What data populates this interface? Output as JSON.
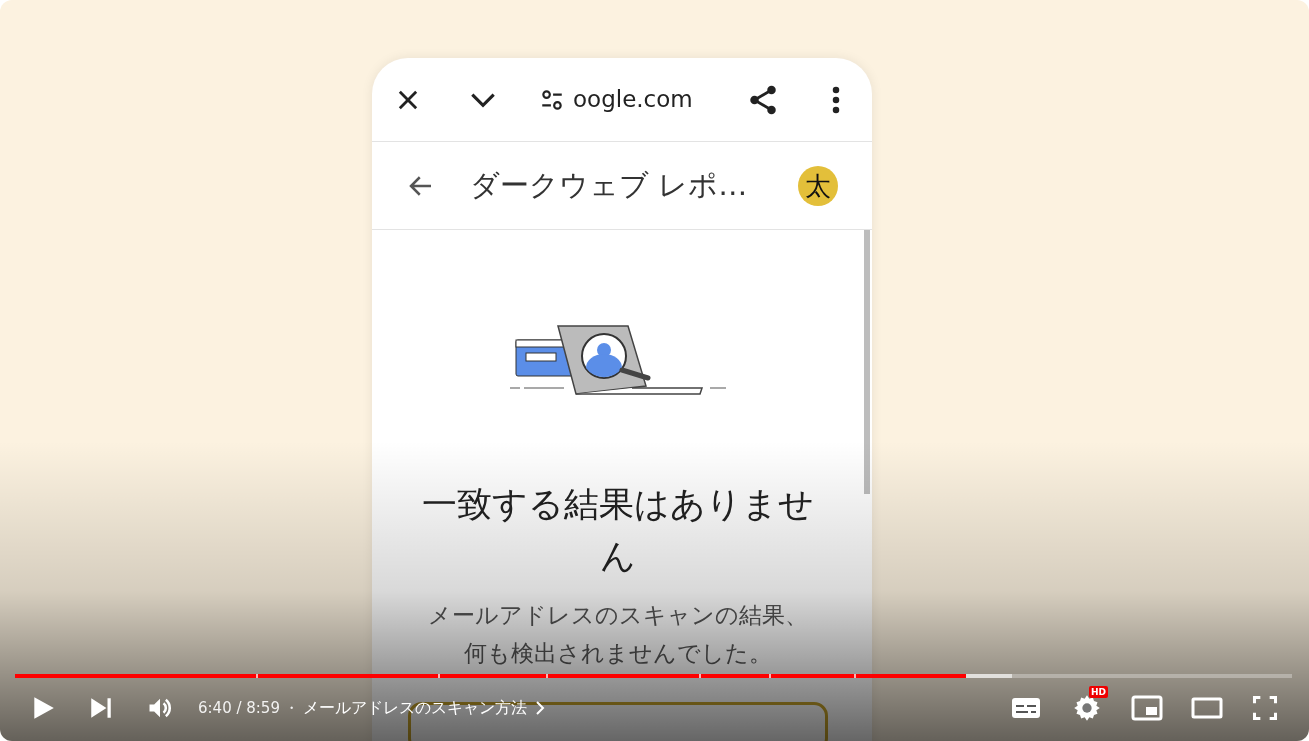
{
  "browser_bar": {
    "url": "oogle.com"
  },
  "page_header": {
    "title": "ダークウェブ レポ…",
    "avatar_initial": "太"
  },
  "result": {
    "heading": "一致する結果はありません",
    "description_lines": [
      "メールアドレスのスキャンの結果、",
      "何も検出されませんでした。"
    ]
  },
  "player": {
    "time": "6:40 / 8:59",
    "separator": "・",
    "chapter": "メールアドレスのスキャン方法",
    "progress": {
      "level": 0.745
    },
    "buffered": {
      "level": 0.781
    },
    "quality_badge": "HD"
  }
}
